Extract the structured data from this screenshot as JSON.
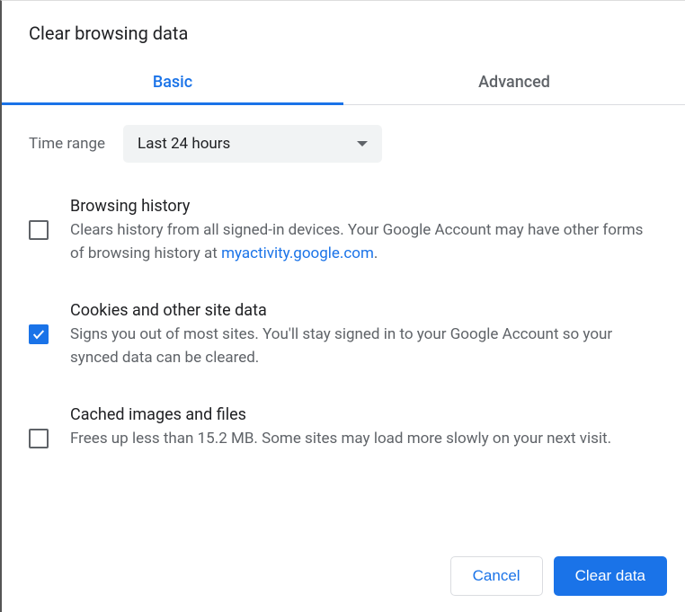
{
  "title": "Clear browsing data",
  "tabs": {
    "basic": "Basic",
    "advanced": "Advanced"
  },
  "timerange": {
    "label": "Time range",
    "selected": "Last 24 hours"
  },
  "options": {
    "browsing": {
      "title": "Browsing history",
      "desc_prefix": "Clears history from all signed-in devices. Your Google Account may have other forms of browsing history at ",
      "link": "myactivity.google.com",
      "desc_suffix": ".",
      "checked": false
    },
    "cookies": {
      "title": "Cookies and other site data",
      "desc": "Signs you out of most sites. You'll stay signed in to your Google Account so your synced data can be cleared.",
      "checked": true
    },
    "cache": {
      "title": "Cached images and files",
      "desc": "Frees up less than 15.2 MB. Some sites may load more slowly on your next visit.",
      "checked": false
    }
  },
  "buttons": {
    "cancel": "Cancel",
    "clear": "Clear data"
  }
}
